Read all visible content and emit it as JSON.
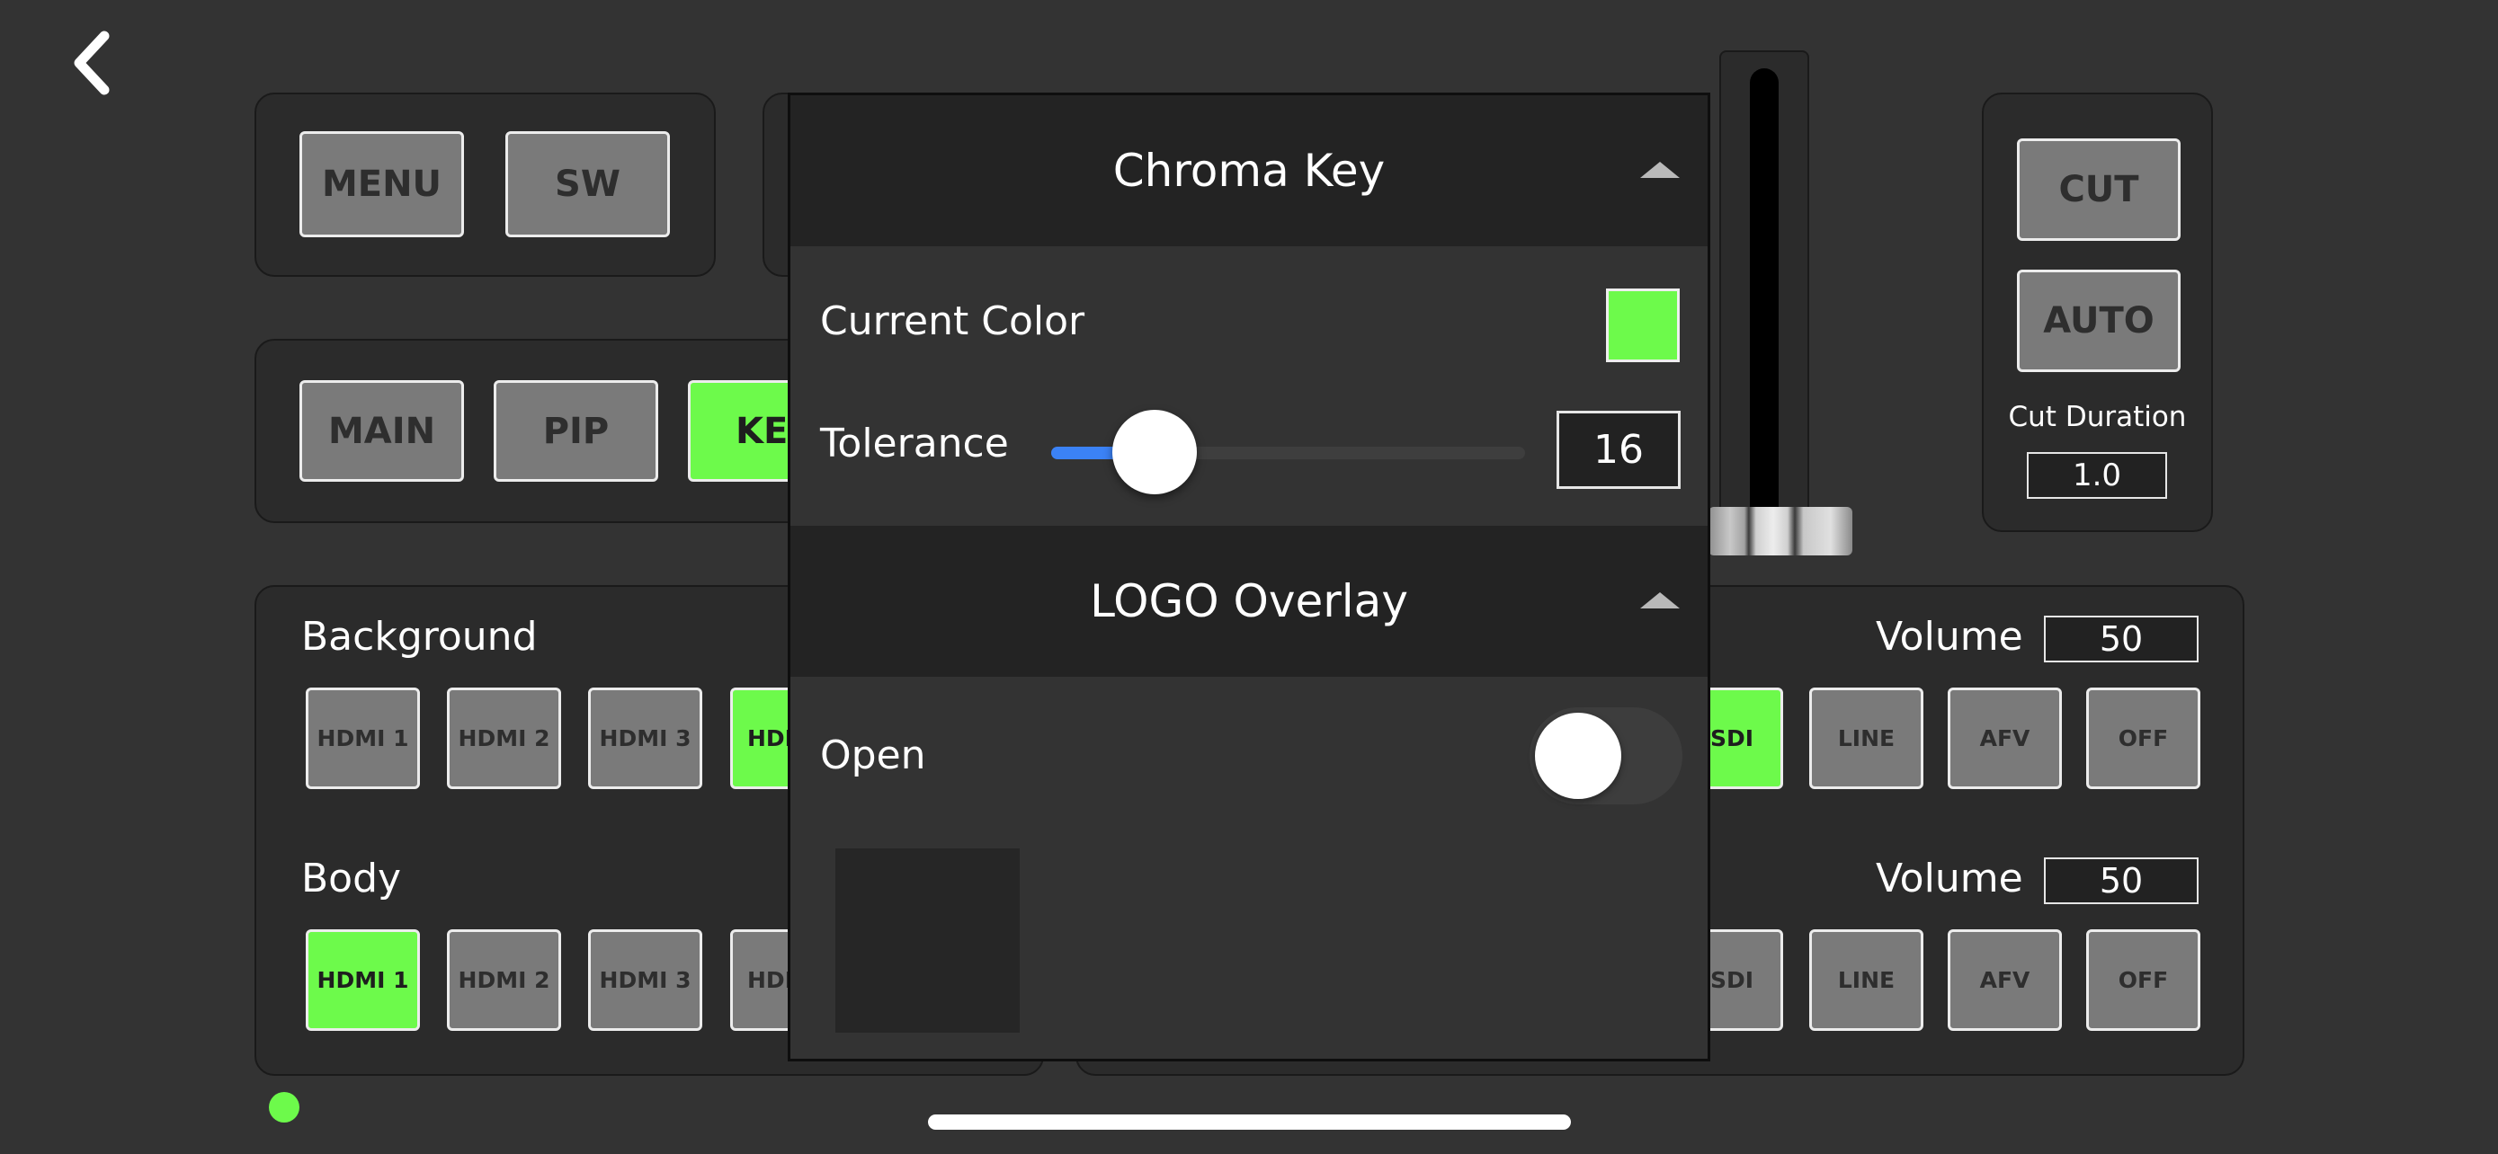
{
  "nav": {
    "back_icon": "chevron-left-icon"
  },
  "top_left": {
    "menu_label": "MENU",
    "sw_label": "SW"
  },
  "modes": {
    "main_label": "MAIN",
    "pip_label": "PIP",
    "key_label": "KEY"
  },
  "transition": {
    "cut_label": "CUT",
    "auto_label": "AUTO",
    "duration_label": "Cut Duration",
    "duration_value": "1.0"
  },
  "background": {
    "title": "Background",
    "sources": [
      "HDMI 1",
      "HDMI 2",
      "HDMI 3",
      "HDMI"
    ],
    "selected_index": 3,
    "volume_label": "Volume",
    "volume_value": "50",
    "audio_sources": [
      "SDI",
      "LINE",
      "AFV",
      "OFF"
    ],
    "audio_selected_index": 0
  },
  "body_row": {
    "title": "Body",
    "sources": [
      "HDMI 1",
      "HDMI 2",
      "HDMI 3",
      "HDMI"
    ],
    "selected_index": 0,
    "volume_label": "Volume",
    "volume_value": "50",
    "audio_sources": [
      "SDI",
      "LINE",
      "AFV",
      "OFF"
    ]
  },
  "popup": {
    "chroma": {
      "title": "Chroma Key",
      "current_color_label": "Current Color",
      "current_color": "#6dfa4b",
      "tolerance_label": "Tolerance",
      "tolerance_value": "16",
      "tolerance_fraction": 0.22
    },
    "logo": {
      "title": "LOGO Overlay",
      "open_label": "Open",
      "open_on": false
    }
  },
  "colors": {
    "accent_green": "#6dfa4b",
    "slider_blue": "#3b82f6"
  }
}
